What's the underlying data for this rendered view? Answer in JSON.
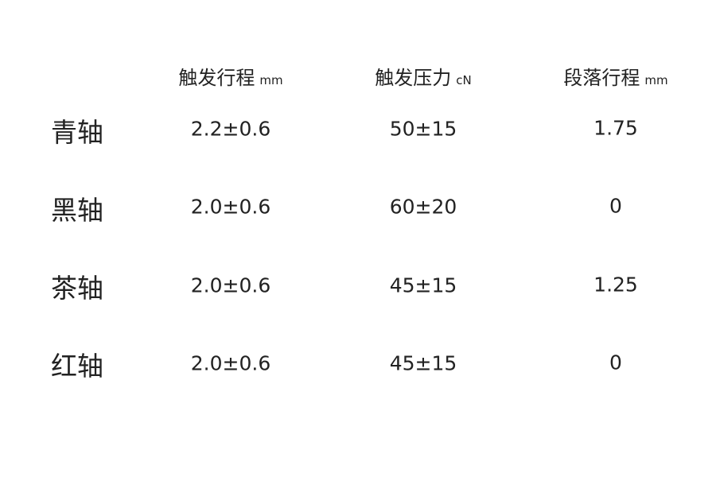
{
  "headers": [
    {
      "label": "触发行程",
      "unit": "mm"
    },
    {
      "label": "触发压力",
      "unit": "cN"
    },
    {
      "label": "段落行程",
      "unit": "mm"
    }
  ],
  "rows": [
    {
      "name": "青轴",
      "values": [
        "2.2±0.6",
        "50±15",
        "1.75"
      ]
    },
    {
      "name": "黑轴",
      "values": [
        "2.0±0.6",
        "60±20",
        "0"
      ]
    },
    {
      "name": "茶轴",
      "values": [
        "2.0±0.6",
        "45±15",
        "1.25"
      ]
    },
    {
      "name": "红轴",
      "values": [
        "2.0±0.6",
        "45±15",
        "0"
      ]
    }
  ]
}
